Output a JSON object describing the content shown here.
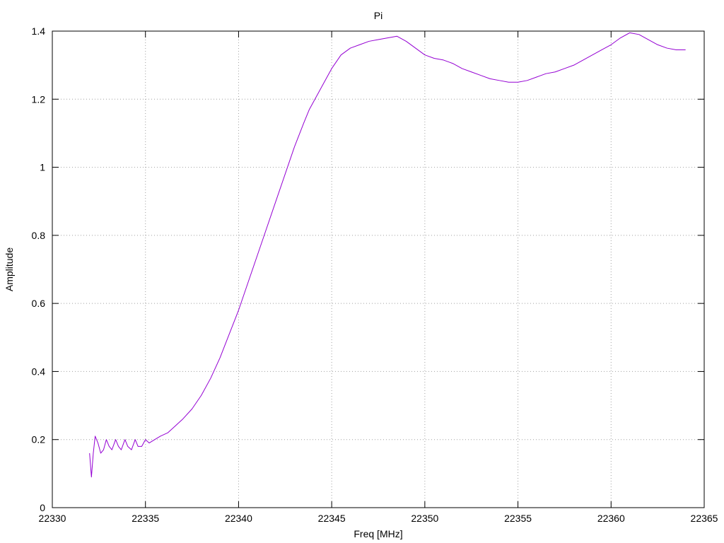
{
  "chart_data": {
    "type": "line",
    "title": "Pi",
    "xlabel": "Freq [MHz]",
    "ylabel": "Amplitude",
    "xlim": [
      22330,
      22365
    ],
    "ylim": [
      0,
      1.4
    ],
    "xticks": [
      22330,
      22335,
      22340,
      22345,
      22350,
      22355,
      22360,
      22365
    ],
    "yticks": [
      0,
      0.2,
      0.4,
      0.6,
      0.8,
      1,
      1.2,
      1.4
    ],
    "xtick_labels": [
      "22330",
      "22335",
      "22340",
      "22345",
      "22350",
      "22355",
      "22360",
      "22365"
    ],
    "ytick_labels": [
      "0",
      "0.2",
      "0.4",
      "0.6",
      "0.8",
      "1",
      "1.2",
      "1.4"
    ],
    "grid": true,
    "series": [
      {
        "color": "#9400d3",
        "points": [
          [
            22332.0,
            0.16
          ],
          [
            22332.1,
            0.09
          ],
          [
            22332.2,
            0.16
          ],
          [
            22332.3,
            0.21
          ],
          [
            22332.45,
            0.19
          ],
          [
            22332.6,
            0.16
          ],
          [
            22332.75,
            0.17
          ],
          [
            22332.9,
            0.2
          ],
          [
            22333.05,
            0.18
          ],
          [
            22333.2,
            0.17
          ],
          [
            22333.4,
            0.2
          ],
          [
            22333.55,
            0.18
          ],
          [
            22333.7,
            0.17
          ],
          [
            22333.9,
            0.2
          ],
          [
            22334.05,
            0.18
          ],
          [
            22334.25,
            0.17
          ],
          [
            22334.45,
            0.2
          ],
          [
            22334.6,
            0.18
          ],
          [
            22334.8,
            0.18
          ],
          [
            22335.0,
            0.2
          ],
          [
            22335.2,
            0.19
          ],
          [
            22335.5,
            0.2
          ],
          [
            22335.8,
            0.21
          ],
          [
            22336.2,
            0.22
          ],
          [
            22336.6,
            0.24
          ],
          [
            22337.0,
            0.26
          ],
          [
            22337.5,
            0.29
          ],
          [
            22338.0,
            0.33
          ],
          [
            22338.5,
            0.38
          ],
          [
            22339.0,
            0.44
          ],
          [
            22339.5,
            0.51
          ],
          [
            22340.0,
            0.58
          ],
          [
            22340.5,
            0.66
          ],
          [
            22341.0,
            0.74
          ],
          [
            22341.5,
            0.82
          ],
          [
            22342.0,
            0.9
          ],
          [
            22342.5,
            0.98
          ],
          [
            22343.0,
            1.06
          ],
          [
            22343.5,
            1.13
          ],
          [
            22343.8,
            1.17
          ],
          [
            22344.0,
            1.19
          ],
          [
            22344.5,
            1.24
          ],
          [
            22345.0,
            1.29
          ],
          [
            22345.5,
            1.33
          ],
          [
            22346.0,
            1.35
          ],
          [
            22346.5,
            1.36
          ],
          [
            22347.0,
            1.37
          ],
          [
            22347.5,
            1.375
          ],
          [
            22348.0,
            1.38
          ],
          [
            22348.5,
            1.385
          ],
          [
            22349.0,
            1.37
          ],
          [
            22349.5,
            1.35
          ],
          [
            22350.0,
            1.33
          ],
          [
            22350.5,
            1.32
          ],
          [
            22351.0,
            1.315
          ],
          [
            22351.5,
            1.305
          ],
          [
            22352.0,
            1.29
          ],
          [
            22352.5,
            1.28
          ],
          [
            22353.0,
            1.27
          ],
          [
            22353.5,
            1.26
          ],
          [
            22354.0,
            1.255
          ],
          [
            22354.5,
            1.25
          ],
          [
            22355.0,
            1.25
          ],
          [
            22355.5,
            1.255
          ],
          [
            22356.0,
            1.265
          ],
          [
            22356.5,
            1.275
          ],
          [
            22357.0,
            1.28
          ],
          [
            22357.5,
            1.29
          ],
          [
            22358.0,
            1.3
          ],
          [
            22358.5,
            1.315
          ],
          [
            22359.0,
            1.33
          ],
          [
            22359.5,
            1.345
          ],
          [
            22360.0,
            1.36
          ],
          [
            22360.5,
            1.38
          ],
          [
            22361.0,
            1.395
          ],
          [
            22361.5,
            1.39
          ],
          [
            22362.0,
            1.375
          ],
          [
            22362.5,
            1.36
          ],
          [
            22363.0,
            1.35
          ],
          [
            22363.5,
            1.345
          ],
          [
            22364.0,
            1.345
          ]
        ]
      }
    ]
  }
}
